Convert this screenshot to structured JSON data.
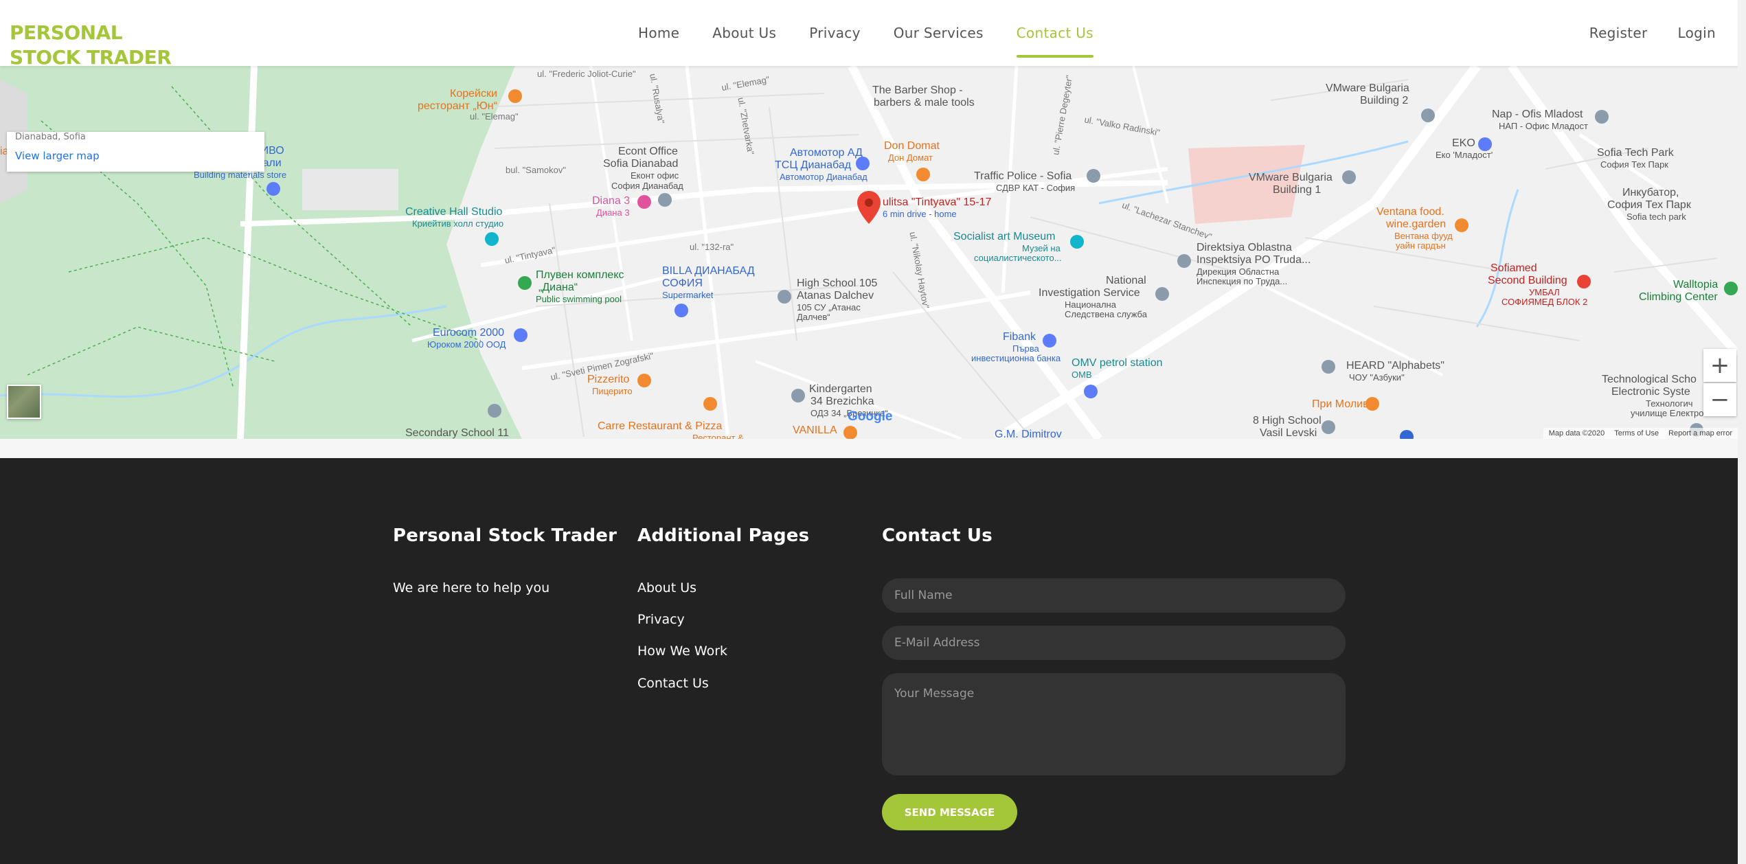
{
  "header": {
    "logo_line1": "PERSONAL",
    "logo_line2": "STOCK TRADER",
    "nav": [
      "Home",
      "About Us",
      "Privacy",
      "Our Services",
      "Contact Us"
    ],
    "active_nav": "Contact Us",
    "register": "Register",
    "login": "Login"
  },
  "map": {
    "card_address": "Dianabad, Sofia",
    "view_larger": "View larger map",
    "marker_label": "ulitsa \"Tintyava\" 15-17",
    "marker_sub": "6 min drive - home",
    "labels": [
      {
        "t": "Корейски",
        "c": "#e8711a"
      },
      {
        "t": "ресторант „Юн“",
        "c": "#e8711a"
      },
      {
        "t": "Магазин ТОПЛИВО",
        "c": "#3367d6"
      },
      {
        "t": "строителни материали",
        "c": "#3367d6"
      },
      {
        "t": "Building materials store",
        "c": "#3367d6"
      },
      {
        "t": "Creative Hall Studio",
        "c": "#1a8a8f"
      },
      {
        "t": "Криейтив холл студио",
        "c": "#1a8a8f"
      },
      {
        "t": "Econt Office",
        "c": "#555"
      },
      {
        "t": "Sofia Dianabad",
        "c": "#555"
      },
      {
        "t": "Еконт офис",
        "c": "#555"
      },
      {
        "t": "София Дианабад",
        "c": "#555"
      },
      {
        "t": "Автомотор АД",
        "c": "#3367d6"
      },
      {
        "t": "ТСЦ Дианабад",
        "c": "#3367d6"
      },
      {
        "t": "Автомотор Дианабад",
        "c": "#3367d6"
      },
      {
        "t": "The Barber Shop -",
        "c": "#555"
      },
      {
        "t": "barbers & male tools",
        "c": "#555"
      },
      {
        "t": "Don Domat",
        "c": "#e8711a"
      },
      {
        "t": "Дон Домат",
        "c": "#e8711a"
      },
      {
        "t": "Traffic Police - Sofia",
        "c": "#555"
      },
      {
        "t": "СДВР КАТ - София",
        "c": "#555"
      },
      {
        "t": "Diana 3",
        "c": "#e0529c"
      },
      {
        "t": "Диана 3",
        "c": "#e0529c"
      },
      {
        "t": "Socialist art Museum",
        "c": "#1a8a8f"
      },
      {
        "t": "Музей на",
        "c": "#1a8a8f"
      },
      {
        "t": "социалистическото...",
        "c": "#1a8a8f"
      },
      {
        "t": "VMware Bulgaria",
        "c": "#555"
      },
      {
        "t": "Building 2",
        "c": "#555"
      },
      {
        "t": "VMware Bulgaria",
        "c": "#555"
      },
      {
        "t": "Building 1",
        "c": "#555"
      },
      {
        "t": "Nap - Ofis Mladost",
        "c": "#555"
      },
      {
        "t": "НАП - Офис Младост",
        "c": "#555"
      },
      {
        "t": "EKO",
        "c": "#555"
      },
      {
        "t": "Еко 'Младост'",
        "c": "#555"
      },
      {
        "t": "Sofia Tech Park",
        "c": "#555"
      },
      {
        "t": "София Тех Парк",
        "c": "#555"
      },
      {
        "t": "Инкубатор,",
        "c": "#555"
      },
      {
        "t": "София Тех Парк",
        "c": "#555"
      },
      {
        "t": "Sofia tech park",
        "c": "#555"
      },
      {
        "t": "Ventana food.",
        "c": "#e8711a"
      },
      {
        "t": "wine.garden",
        "c": "#e8711a"
      },
      {
        "t": "Вентана фууд",
        "c": "#e8711a"
      },
      {
        "t": "уайн гардън",
        "c": "#e8711a"
      },
      {
        "t": "Sofiamed",
        "c": "#c5221f"
      },
      {
        "t": "Second Building",
        "c": "#c5221f"
      },
      {
        "t": "УМБАЛ",
        "c": "#c5221f"
      },
      {
        "t": "СОФИЯМЕД БЛОК 2",
        "c": "#c5221f"
      },
      {
        "t": "Walltopia",
        "c": "#188038"
      },
      {
        "t": "Climbing Center",
        "c": "#188038"
      },
      {
        "t": "Плувен комплекс",
        "c": "#188038"
      },
      {
        "t": "„Диана“",
        "c": "#188038"
      },
      {
        "t": "Public swimming pool",
        "c": "#188038"
      },
      {
        "t": "BILLA ДИАНАБАД",
        "c": "#3367d6"
      },
      {
        "t": "СОФИЯ",
        "c": "#3367d6"
      },
      {
        "t": "Supermarket",
        "c": "#3367d6"
      },
      {
        "t": "High School 105",
        "c": "#555"
      },
      {
        "t": "Atanas Dalchev",
        "c": "#555"
      },
      {
        "t": "105 СУ „Атанас",
        "c": "#555"
      },
      {
        "t": "Далчев“",
        "c": "#555"
      },
      {
        "t": "Direktsiya Oblastna",
        "c": "#555"
      },
      {
        "t": "Inspektsiya PO Truda...",
        "c": "#555"
      },
      {
        "t": "Дирекция Областна",
        "c": "#555"
      },
      {
        "t": "Инспекция по Труда...",
        "c": "#555"
      },
      {
        "t": "National",
        "c": "#555"
      },
      {
        "t": "Investigation Service",
        "c": "#555"
      },
      {
        "t": "Национална",
        "c": "#555"
      },
      {
        "t": "Следствена служба",
        "c": "#555"
      },
      {
        "t": "Eurocom 2000",
        "c": "#3367d6"
      },
      {
        "t": "Юроком 2000 ООД",
        "c": "#3367d6"
      },
      {
        "t": "Fibank",
        "c": "#3367d6"
      },
      {
        "t": "Първа",
        "c": "#3367d6"
      },
      {
        "t": "инвестиционна банка",
        "c": "#3367d6"
      },
      {
        "t": "OMV petrol station",
        "c": "#1a8a8f"
      },
      {
        "t": "ОМВ",
        "c": "#1a8a8f"
      },
      {
        "t": "HEARD \"Alphabets\"",
        "c": "#555"
      },
      {
        "t": "ЧОУ \"Азбуки\"",
        "c": "#555"
      },
      {
        "t": "Technological Scho",
        "c": "#555"
      },
      {
        "t": "Electronic Syste",
        "c": "#555"
      },
      {
        "t": "Технологич",
        "c": "#555"
      },
      {
        "t": "училище Електрон",
        "c": "#555"
      },
      {
        "t": "Pizzerito",
        "c": "#e8711a"
      },
      {
        "t": "Пицерито",
        "c": "#e8711a"
      },
      {
        "t": "Kindergarten",
        "c": "#555"
      },
      {
        "t": "34 Brezichka",
        "c": "#555"
      },
      {
        "t": "ОДЗ 34 „Брезичка“",
        "c": "#555"
      },
      {
        "t": "При Молива",
        "c": "#e8711a"
      },
      {
        "t": "8 High School",
        "c": "#555"
      },
      {
        "t": "Vasil Levski",
        "c": "#555"
      },
      {
        "t": "Carre Restaurant & Pizza",
        "c": "#e8711a"
      },
      {
        "t": "Ресторант &",
        "c": "#e8711a"
      },
      {
        "t": "VANILLA",
        "c": "#e8711a"
      },
      {
        "t": "Secondary School 11",
        "c": "#555"
      },
      {
        "t": "G.M. Dimitrov",
        "c": "#3367d6"
      }
    ],
    "streets": [
      "ul. \"Frederic Joliot-Curie\"",
      "ul. \"Elemag\"",
      "ul. \"Elemag\"",
      "bul. \"Samokov\"",
      "ul. \"Rusalya\"",
      "ul. \"Zhetvarka\"",
      "ul. \"Valko Radinski\"",
      "ul. \"Tintyava\"",
      "ul. \"132-ra\"",
      "ul. \"Sveti Pimen Zografski\"",
      "ul. \"Nikolay Haytov\"",
      "ul. \"Lachezar Stanchev\"",
      "ul. \"Pierre Degeyter\"",
      "ia"
    ],
    "google": "Google",
    "footer_items": [
      "Map data ©2020",
      "Terms of Use",
      "Report a map error"
    ],
    "zoom_in": "+",
    "zoom_out": "−"
  },
  "footer": {
    "col1_title": "Personal Stock Trader",
    "col1_text": "We are here to help you",
    "col2_title": "Additional Pages",
    "col2_links": [
      "About Us",
      "Privacy",
      "How We Work",
      "Contact Us"
    ],
    "col3_title": "Contact Us",
    "form": {
      "name_placeholder": "Full Name",
      "email_placeholder": "E-Mail Address",
      "message_placeholder": "Your Message",
      "send_label": "SEND MESSAGE"
    }
  },
  "colors": {
    "accent": "#a4c639",
    "footer_bg": "#222222",
    "input_bg": "#333333",
    "park": "#c8e6c9"
  }
}
